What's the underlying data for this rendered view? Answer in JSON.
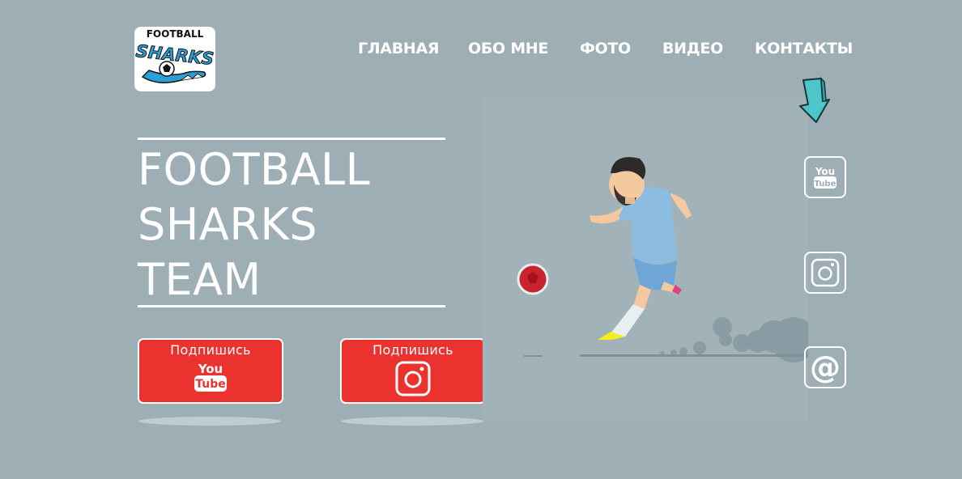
{
  "logo": {
    "word_top": "FOOTBALL",
    "word_main": "SHARKS"
  },
  "nav": {
    "items": [
      {
        "label": "ГЛАВНАЯ"
      },
      {
        "label": "ОБО МНЕ"
      },
      {
        "label": "ФОТО"
      },
      {
        "label": "ВИДЕО"
      },
      {
        "label": "КОНТАКТЫ"
      }
    ]
  },
  "hero": {
    "title_lines": [
      "FOOTBALL",
      "SHARKS",
      "TEAM"
    ]
  },
  "buttons": {
    "youtube": {
      "label": "Подпишись",
      "icon": "youtube-icon",
      "icon_text_top": "You",
      "icon_text_bottom": "Tube"
    },
    "instagram": {
      "label": "Подпишись",
      "icon": "instagram-icon"
    }
  },
  "social": {
    "youtube": {
      "icon": "youtube-icon",
      "text_top": "You",
      "text_bottom": "Tube"
    },
    "instagram": {
      "icon": "instagram-icon"
    },
    "email": {
      "icon": "at-sign-icon",
      "symbol": "@"
    }
  },
  "colors": {
    "background": "#9daeb5",
    "button_red": "#ec322f",
    "arrow_teal": "#4ec5c9",
    "logo_blue": "#2a9fd6"
  }
}
